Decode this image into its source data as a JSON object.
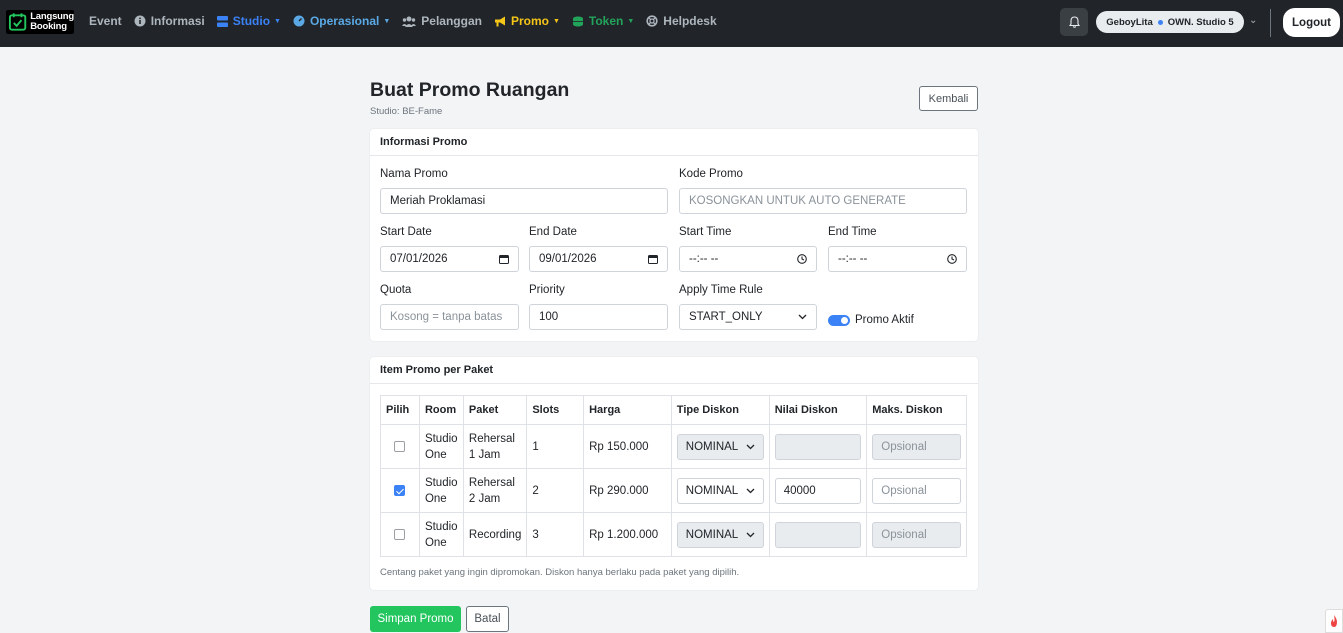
{
  "brand": {
    "line1": "Langsung",
    "line2": "Booking"
  },
  "nav": [
    {
      "label": "Event",
      "icon": "none"
    },
    {
      "label": "Informasi",
      "icon": "info-icon"
    },
    {
      "label": "Studio",
      "icon": "server-icon",
      "caret": true
    },
    {
      "label": "Operasional",
      "icon": "gauge-icon",
      "caret": true
    },
    {
      "label": "Pelanggan",
      "icon": "users-icon"
    },
    {
      "label": "Promo",
      "icon": "bullhorn-icon",
      "caret": true
    },
    {
      "label": "Token",
      "icon": "coins-icon",
      "caret": true
    },
    {
      "label": "Helpdesk",
      "icon": "lifebuoy-icon"
    }
  ],
  "user": {
    "name": "GeboyLita",
    "role": "OWN. Studio 5"
  },
  "logout_label": "Logout",
  "page": {
    "title": "Buat Promo Ruangan",
    "subtitle": "Studio: BE-Fame",
    "back_label": "Kembali"
  },
  "promo_info": {
    "header": "Informasi Promo",
    "nama_label": "Nama Promo",
    "nama_value": "Meriah Proklamasi",
    "kode_label": "Kode Promo",
    "kode_placeholder": "KOSONGKAN UNTUK AUTO GENERATE",
    "start_date_label": "Start Date",
    "start_date_value": "07/01/2026",
    "end_date_label": "End Date",
    "end_date_value": "09/01/2026",
    "start_time_label": "Start Time",
    "start_time_value": "--:-- --",
    "end_time_label": "End Time",
    "end_time_value": "--:-- --",
    "quota_label": "Quota",
    "quota_placeholder": "Kosong = tanpa batas",
    "priority_label": "Priority",
    "priority_value": "100",
    "time_rule_label": "Apply Time Rule",
    "time_rule_value": "START_ONLY",
    "aktif_label": "Promo Aktif",
    "aktif": true
  },
  "items": {
    "header": "Item Promo per Paket",
    "columns": [
      "Pilih",
      "Room",
      "Paket",
      "Slots",
      "Harga",
      "Tipe Diskon",
      "Nilai Diskon",
      "Maks. Diskon"
    ],
    "rows": [
      {
        "checked": false,
        "room": "Studio One",
        "paket": "Rehersal 1 Jam",
        "slots": "1",
        "harga": "Rp 150.000",
        "tipe": "NOMINAL",
        "nilai": "",
        "maks_placeholder": "Opsional"
      },
      {
        "checked": true,
        "room": "Studio One",
        "paket": "Rehersal 2 Jam",
        "slots": "2",
        "harga": "Rp 290.000",
        "tipe": "NOMINAL",
        "nilai": "40000",
        "maks_placeholder": "Opsional"
      },
      {
        "checked": false,
        "room": "Studio One",
        "paket": "Recording",
        "slots": "3",
        "harga": "Rp 1.200.000",
        "tipe": "NOMINAL",
        "nilai": "",
        "maks_placeholder": "Opsional"
      }
    ],
    "note": "Centang paket yang ingin dipromokan. Diskon hanya berlaku pada paket yang dipilih."
  },
  "actions": {
    "save_label": "Simpan Promo",
    "cancel_label": "Batal"
  }
}
